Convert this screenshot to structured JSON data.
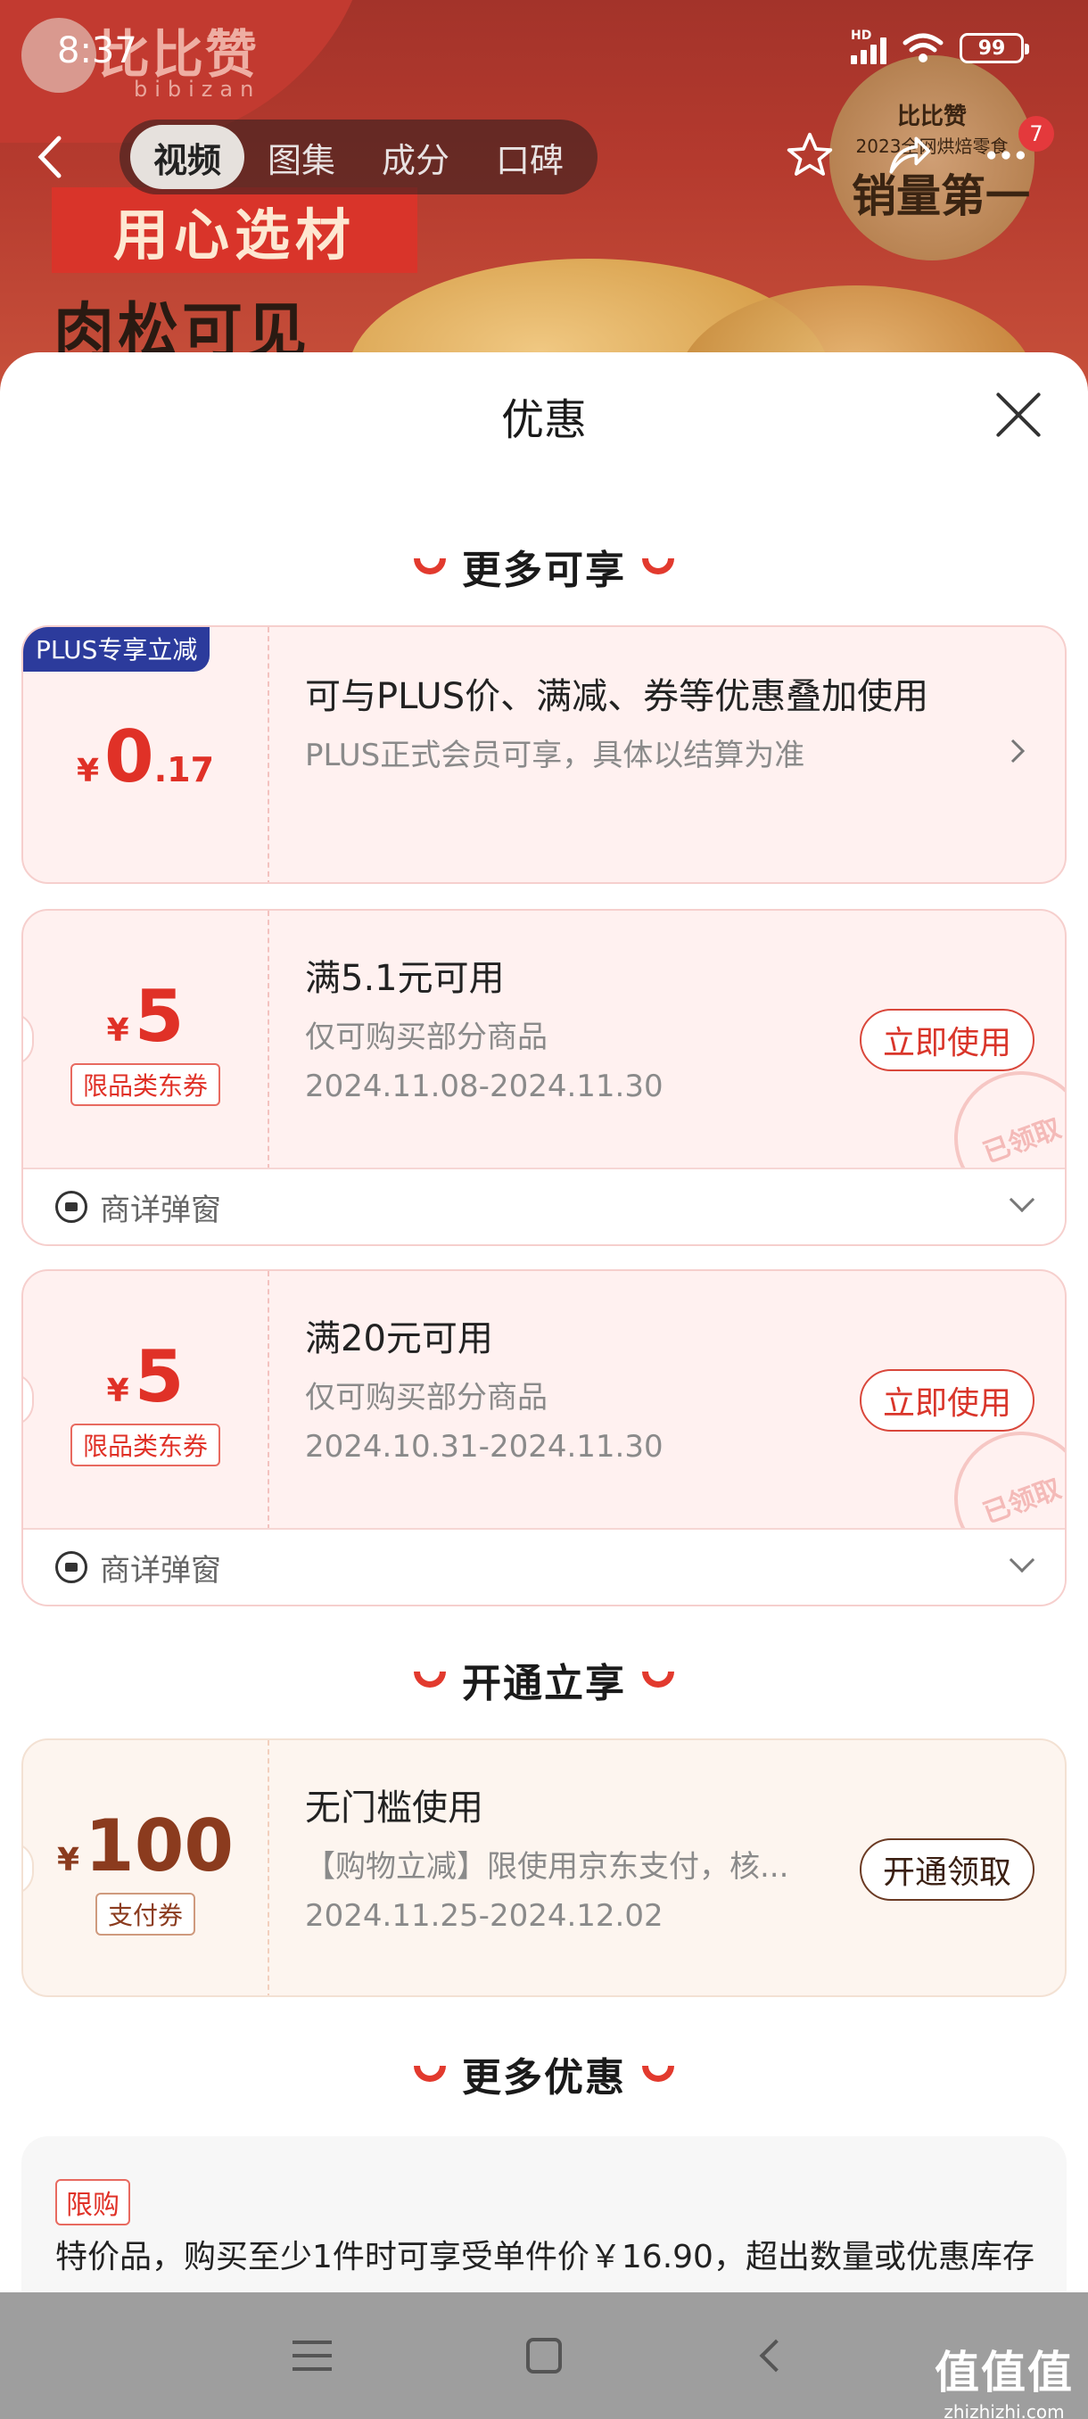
{
  "status_bar": {
    "time": "8:37",
    "network": "HD",
    "battery": "99"
  },
  "background": {
    "brand_logo": "比比赞",
    "brand_sub": "bibizan",
    "tag_line1": "用心选材",
    "tag_line2": "肉松可见",
    "badge_logo": "比比赞",
    "badge_year": "2023全网烘焙零食",
    "badge_text": "销量第一"
  },
  "top_nav": {
    "tabs": [
      {
        "label": "视频",
        "active": true
      },
      {
        "label": "图集",
        "active": false
      },
      {
        "label": "成分",
        "active": false
      },
      {
        "label": "口碑",
        "active": false
      }
    ],
    "more_badge": "7",
    "icons": [
      "back-icon",
      "star-icon",
      "share-icon",
      "more-icon"
    ]
  },
  "sheet": {
    "title": "优惠",
    "sections": {
      "more_available": "更多可享",
      "open_now": "开通立享",
      "more_discounts": "更多优惠"
    },
    "plus_card": {
      "label": "PLUS专享立减",
      "currency": "¥",
      "amount_int": "0",
      "amount_dec": ".17",
      "title": "可与PLUS价、满减、券等优惠叠加使用",
      "subtitle": "PLUS正式会员可享，具体以结算为准"
    },
    "coupons": [
      {
        "currency": "¥",
        "amount": "5",
        "chip": "限品类东券",
        "title": "满5.1元可用",
        "subtitle": "仅可购买部分商品",
        "date": "2024.11.08-2024.11.30",
        "button": "立即使用",
        "stamp": "已领取",
        "footer": "商详弹窗"
      },
      {
        "currency": "¥",
        "amount": "5",
        "chip": "限品类东券",
        "title": "满20元可用",
        "subtitle": "仅可购买部分商品",
        "date": "2024.10.31-2024.11.30",
        "button": "立即使用",
        "stamp": "已领取",
        "footer": "商详弹窗"
      }
    ],
    "pay_coupon": {
      "currency": "¥",
      "amount": "100",
      "chip": "支付券",
      "title": "无门槛使用",
      "subtitle": "【购物立减】限使用京东支付，核...",
      "date": "2024.11.25-2024.12.02",
      "button": "开通领取"
    },
    "info": {
      "tag": "限购",
      "text": "特价品，购买至少1件时可享受单件价￥16.90，超出数量或优惠库存"
    }
  },
  "watermark": {
    "line1": "值值值",
    "line2": "zhizhizhi.com"
  },
  "colors": {
    "accent": "#e03127",
    "plus_blue": "#2c3b9c",
    "gold_text": "#8b3b1e"
  }
}
